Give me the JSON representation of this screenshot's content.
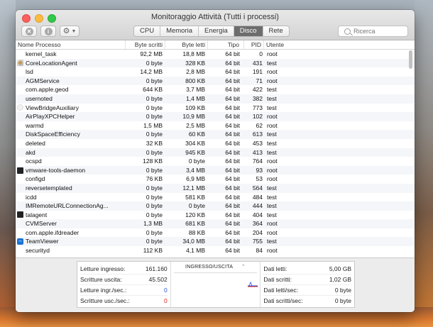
{
  "window": {
    "title": "Monitoraggio Attività (Tutti i processi)"
  },
  "toolbar": {
    "tabs": [
      {
        "label": "CPU",
        "selected": false
      },
      {
        "label": "Memoria",
        "selected": false
      },
      {
        "label": "Energia",
        "selected": false
      },
      {
        "label": "Disco",
        "selected": true
      },
      {
        "label": "Rete",
        "selected": false
      }
    ],
    "search_placeholder": "Ricerca",
    "icons": {
      "close": "close-process-icon",
      "info": "info-icon",
      "gear": "gear-icon"
    }
  },
  "table": {
    "headers": {
      "name": "Nome Processo",
      "bytes_written": "Byte scritti",
      "bytes_read": "Byte letti",
      "type": "Tipo",
      "pid": "PID",
      "user": "Utente"
    },
    "rows": [
      {
        "name": "kernel_task",
        "icon": "",
        "written": "92,2 MB",
        "read": "18,8 MB",
        "type": "64 bit",
        "pid": "0",
        "user": "root"
      },
      {
        "name": "CoreLocationAgent",
        "icon": "location",
        "written": "0 byte",
        "read": "328 KB",
        "type": "64 bit",
        "pid": "431",
        "user": "test"
      },
      {
        "name": "lsd",
        "icon": "",
        "written": "14,2 MB",
        "read": "2,8 MB",
        "type": "64 bit",
        "pid": "191",
        "user": "root"
      },
      {
        "name": "AGMService",
        "icon": "",
        "written": "0 byte",
        "read": "800 KB",
        "type": "64 bit",
        "pid": "71",
        "user": "root"
      },
      {
        "name": "com.apple.geod",
        "icon": "",
        "written": "644 KB",
        "read": "3,7 MB",
        "type": "64 bit",
        "pid": "422",
        "user": "test"
      },
      {
        "name": "usernoted",
        "icon": "",
        "written": "0 byte",
        "read": "1,4 MB",
        "type": "64 bit",
        "pid": "382",
        "user": "test"
      },
      {
        "name": "ViewBridgeAuxiliary",
        "icon": "viewbridge",
        "written": "0 byte",
        "read": "109 KB",
        "type": "64 bit",
        "pid": "773",
        "user": "test"
      },
      {
        "name": "AirPlayXPCHelper",
        "icon": "",
        "written": "0 byte",
        "read": "10,9 MB",
        "type": "64 bit",
        "pid": "102",
        "user": "root"
      },
      {
        "name": "warmd",
        "icon": "",
        "written": "1,5 MB",
        "read": "2,5 MB",
        "type": "64 bit",
        "pid": "62",
        "user": "root"
      },
      {
        "name": "DiskSpaceEfficiency",
        "icon": "",
        "written": "0 byte",
        "read": "60 KB",
        "type": "64 bit",
        "pid": "613",
        "user": "test"
      },
      {
        "name": "deleted",
        "icon": "",
        "written": "32 KB",
        "read": "304 KB",
        "type": "64 bit",
        "pid": "453",
        "user": "test"
      },
      {
        "name": "akd",
        "icon": "",
        "written": "0 byte",
        "read": "945 KB",
        "type": "64 bit",
        "pid": "413",
        "user": "test"
      },
      {
        "name": "ocspd",
        "icon": "",
        "written": "128 KB",
        "read": "0 byte",
        "type": "64 bit",
        "pid": "764",
        "user": "root"
      },
      {
        "name": "vmware-tools-daemon",
        "icon": "terminal",
        "written": "0 byte",
        "read": "3,4 MB",
        "type": "64 bit",
        "pid": "93",
        "user": "root"
      },
      {
        "name": "configd",
        "icon": "",
        "written": "76 KB",
        "read": "6,9 MB",
        "type": "64 bit",
        "pid": "53",
        "user": "root"
      },
      {
        "name": "reversetemplated",
        "icon": "",
        "written": "0 byte",
        "read": "12,1 MB",
        "type": "64 bit",
        "pid": "564",
        "user": "test"
      },
      {
        "name": "icdd",
        "icon": "",
        "written": "0 byte",
        "read": "581 KB",
        "type": "64 bit",
        "pid": "484",
        "user": "test"
      },
      {
        "name": "IMRemoteURLConnectionAg...",
        "icon": "",
        "written": "0 byte",
        "read": "0 byte",
        "type": "64 bit",
        "pid": "444",
        "user": "test"
      },
      {
        "name": "talagent",
        "icon": "terminal",
        "written": "0 byte",
        "read": "120 KB",
        "type": "64 bit",
        "pid": "404",
        "user": "test"
      },
      {
        "name": "CVMServer",
        "icon": "",
        "written": "1,3 MB",
        "read": "681 KB",
        "type": "64 bit",
        "pid": "364",
        "user": "root"
      },
      {
        "name": "com.apple.ifdreader",
        "icon": "",
        "written": "0 byte",
        "read": "88 KB",
        "type": "64 bit",
        "pid": "204",
        "user": "root"
      },
      {
        "name": "TeamViewer",
        "icon": "teamviewer",
        "written": "0 byte",
        "read": "34,0 MB",
        "type": "64 bit",
        "pid": "755",
        "user": "test"
      },
      {
        "name": "securityd",
        "icon": "",
        "written": "112 KB",
        "read": "4,1 MB",
        "type": "64 bit",
        "pid": "84",
        "user": "root"
      }
    ]
  },
  "stats": {
    "left": [
      {
        "label": "Letture ingresso:",
        "value": "161.160",
        "color": ""
      },
      {
        "label": "Scritture uscita:",
        "value": "45.502",
        "color": ""
      },
      {
        "label": "Letture ingr./sec.:",
        "value": "0",
        "color": "#2a4fd8"
      },
      {
        "label": "Scritture usc./sec.:",
        "value": "0",
        "color": "#e0211c"
      }
    ],
    "graph_selector": "INGRESSO/USCITA",
    "right": [
      {
        "label": "Dati letti:",
        "value": "5,00 GB"
      },
      {
        "label": "Dati scritti:",
        "value": "1,02 GB"
      },
      {
        "label": "Dati letti/sec:",
        "value": "0 byte"
      },
      {
        "label": "Dati scritti/sec:",
        "value": "0 byte"
      }
    ]
  }
}
